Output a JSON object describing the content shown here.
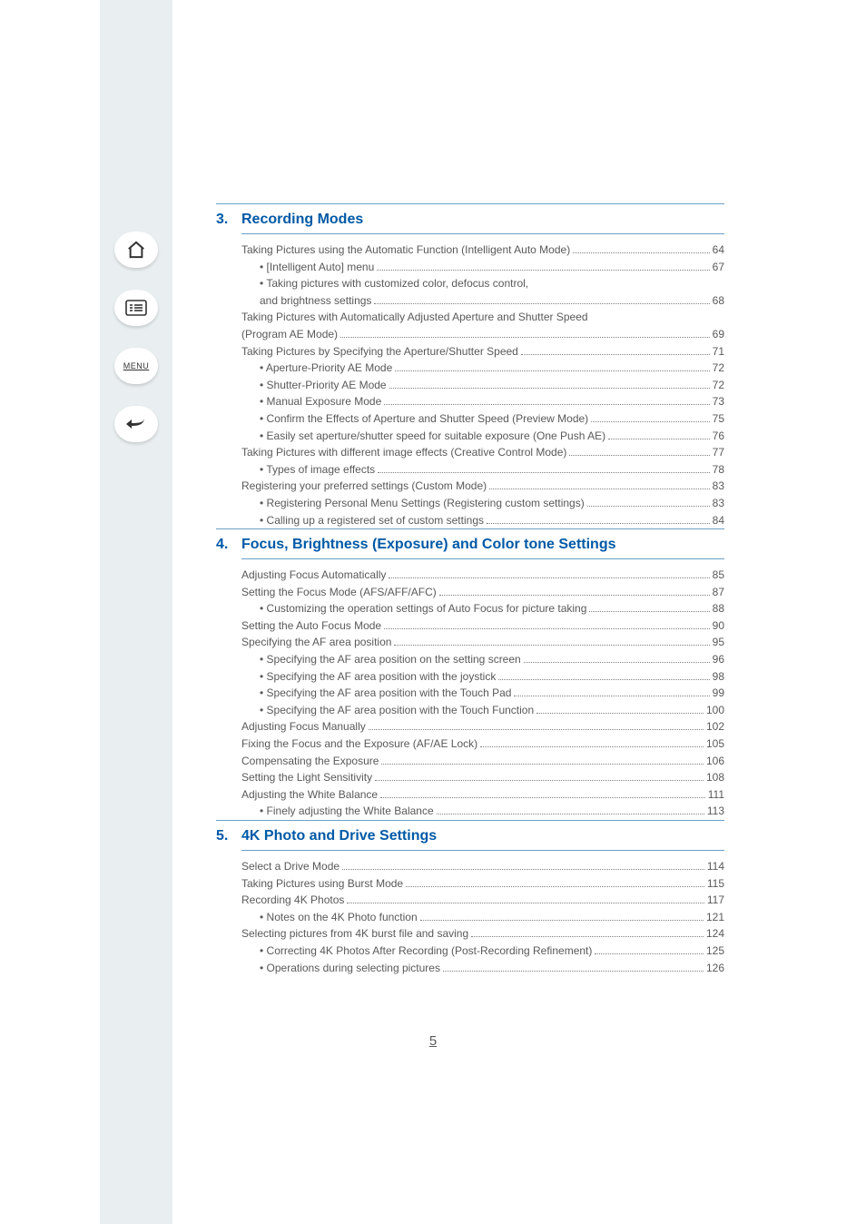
{
  "sidebar": {
    "home_label": "home-icon",
    "contents_label": "contents-icon",
    "menu_label": "MENU",
    "back_label": "back-icon"
  },
  "sections": [
    {
      "num": "3.",
      "title": "Recording Modes",
      "items": [
        {
          "level": 1,
          "label": "Taking Pictures using the Automatic Function (Intelligent Auto Mode)",
          "page": "64"
        },
        {
          "level": 2,
          "label": "• [Intelligent Auto] menu",
          "page": "67"
        },
        {
          "level": 2,
          "label_cont": "• Taking pictures with customized color, defocus control,",
          "label": "and brightness settings",
          "page": "68"
        },
        {
          "level": 1,
          "label_cont": "Taking Pictures with Automatically Adjusted Aperture and Shutter Speed",
          "label": "(Program AE Mode)",
          "page": "69"
        },
        {
          "level": 1,
          "label": "Taking Pictures by Specifying the Aperture/Shutter Speed",
          "page": "71"
        },
        {
          "level": 2,
          "label": "• Aperture-Priority AE Mode",
          "page": "72"
        },
        {
          "level": 2,
          "label": "• Shutter-Priority AE Mode",
          "page": "72"
        },
        {
          "level": 2,
          "label": "• Manual Exposure Mode",
          "page": "73"
        },
        {
          "level": 2,
          "label": "• Confirm the Effects of Aperture and Shutter Speed (Preview Mode)",
          "page": "75"
        },
        {
          "level": 2,
          "label": "• Easily set aperture/shutter speed for suitable exposure (One Push AE)",
          "page": "76"
        },
        {
          "level": 1,
          "label": "Taking Pictures with different image effects (Creative Control Mode)",
          "page": "77"
        },
        {
          "level": 2,
          "label": "• Types of image effects",
          "page": "78"
        },
        {
          "level": 1,
          "label": "Registering your preferred settings (Custom Mode)",
          "page": "83"
        },
        {
          "level": 2,
          "label": "• Registering Personal Menu Settings (Registering custom settings)",
          "page": "83"
        },
        {
          "level": 2,
          "label": "• Calling up a registered set of custom settings",
          "page": "84"
        }
      ]
    },
    {
      "num": "4.",
      "title": "Focus, Brightness (Exposure) and Color tone Settings",
      "items": [
        {
          "level": 1,
          "label": "Adjusting Focus Automatically",
          "page": "85"
        },
        {
          "level": 1,
          "label": "Setting the Focus Mode (AFS/AFF/AFC)",
          "page": "87"
        },
        {
          "level": 2,
          "label": "• Customizing the operation settings of Auto Focus for picture taking",
          "page": "88"
        },
        {
          "level": 1,
          "label": "Setting the Auto Focus Mode",
          "page": "90"
        },
        {
          "level": 1,
          "label": "Specifying the AF area position",
          "page": "95"
        },
        {
          "level": 2,
          "label": "• Specifying the AF area position on the setting screen",
          "page": "96"
        },
        {
          "level": 2,
          "label": "• Specifying the AF area position with the joystick",
          "page": "98"
        },
        {
          "level": 2,
          "label": "• Specifying the AF area position with the Touch Pad",
          "page": "99"
        },
        {
          "level": 2,
          "label": "• Specifying the AF area position with the Touch Function",
          "page": "100"
        },
        {
          "level": 1,
          "label": "Adjusting Focus Manually",
          "page": "102"
        },
        {
          "level": 1,
          "label": "Fixing the Focus and the Exposure (AF/AE Lock)",
          "page": "105"
        },
        {
          "level": 1,
          "label": "Compensating the Exposure",
          "page": "106"
        },
        {
          "level": 1,
          "label": "Setting the Light Sensitivity",
          "page": "108"
        },
        {
          "level": 1,
          "label": "Adjusting the White Balance",
          "page": "111"
        },
        {
          "level": 2,
          "label": "• Finely adjusting the White Balance",
          "page": "113"
        }
      ]
    },
    {
      "num": "5.",
      "title": "4K Photo and Drive Settings",
      "items": [
        {
          "level": 1,
          "label": "Select a Drive Mode",
          "page": "114"
        },
        {
          "level": 1,
          "label": "Taking Pictures using Burst Mode",
          "page": "115"
        },
        {
          "level": 1,
          "label": "Recording 4K Photos",
          "page": "117"
        },
        {
          "level": 2,
          "label": "• Notes on the 4K Photo function",
          "page": "121"
        },
        {
          "level": 1,
          "label": "Selecting pictures from 4K burst file and saving",
          "page": "124"
        },
        {
          "level": 2,
          "label": "• Correcting 4K Photos After Recording (Post-Recording Refinement)",
          "page": "125"
        },
        {
          "level": 2,
          "label": "• Operations during selecting pictures",
          "page": "126"
        }
      ]
    }
  ],
  "page_number": "5"
}
